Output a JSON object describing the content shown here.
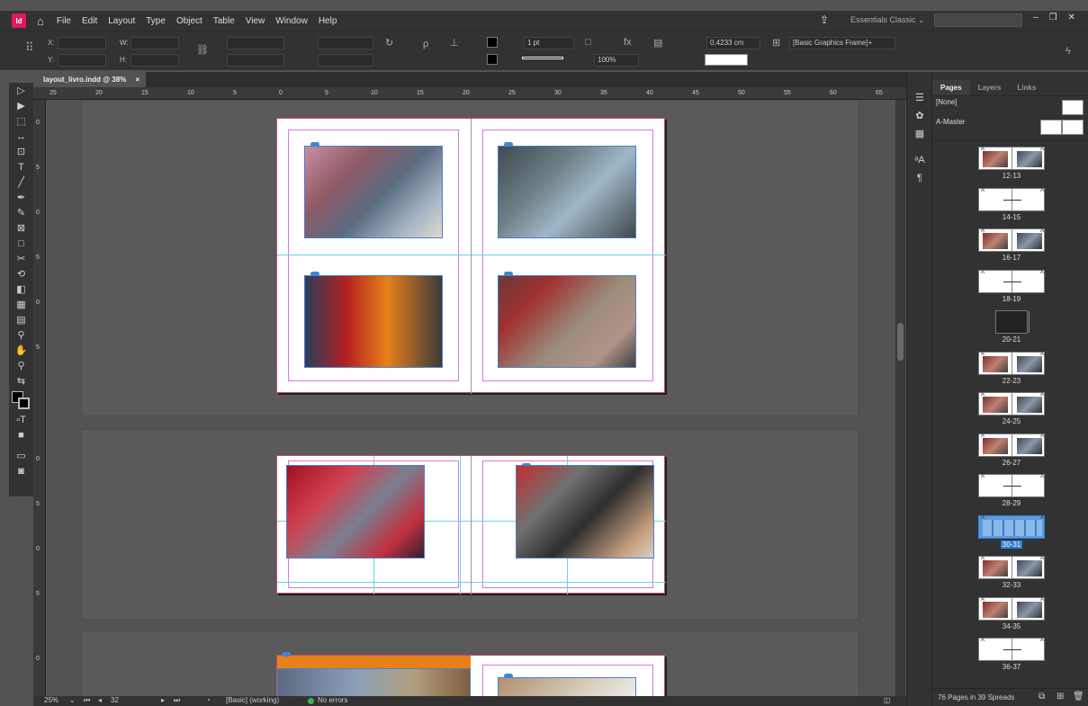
{
  "app": {
    "icon_label": "Id"
  },
  "menu": [
    "File",
    "Edit",
    "Layout",
    "Type",
    "Object",
    "Table",
    "View",
    "Window",
    "Help"
  ],
  "workspace": "Essentials Classic",
  "control": {
    "x_label": "X:",
    "y_label": "Y:",
    "w_label": "W:",
    "h_label": "H:",
    "stroke_weight": "1 pt",
    "opacity": "100%",
    "offset": "0,4233 cm",
    "object_style": "[Basic Graphics Frame]+"
  },
  "document_tab": {
    "title": "layout_livro.indd @ 38%",
    "close": "×"
  },
  "ruler_h": [
    "25",
    "20",
    "15",
    "10",
    "5",
    "0",
    "5",
    "10",
    "15",
    "20",
    "25",
    "30",
    "35",
    "40",
    "45",
    "50",
    "55",
    "60",
    "65"
  ],
  "ruler_v": [
    "0",
    "5",
    "0",
    "5",
    "0",
    "5",
    "0",
    "5",
    "0",
    "5",
    "0",
    "5",
    "0",
    "5"
  ],
  "panel": {
    "tabs": [
      "Pages",
      "Layers",
      "Links"
    ],
    "masters": [
      "[None]",
      "A-Master"
    ],
    "spreads": [
      {
        "label": "12-13",
        "kind": "photo"
      },
      {
        "label": "14-15",
        "kind": "blank"
      },
      {
        "label": "16-17",
        "kind": "photo"
      },
      {
        "label": "18-19",
        "kind": "blank"
      },
      {
        "label": "20-21",
        "kind": "dark"
      },
      {
        "label": "22-23",
        "kind": "photo"
      },
      {
        "label": "24-25",
        "kind": "photo"
      },
      {
        "label": "26-27",
        "kind": "photo"
      },
      {
        "label": "28-29",
        "kind": "blank"
      },
      {
        "label": "30-31",
        "kind": "selected"
      },
      {
        "label": "32-33",
        "kind": "photo"
      },
      {
        "label": "34-35",
        "kind": "photo"
      },
      {
        "label": "36-37",
        "kind": "blank"
      }
    ],
    "footer": "76 Pages in 39 Spreads",
    "master_letter": "A"
  },
  "status": {
    "zoom": "25%",
    "page": "32",
    "style": "[Basic] (working)",
    "errors": "No errors"
  },
  "colors": {
    "accent": "#2f7fd7",
    "app_brand": "#e2175f",
    "preflight_ok": "#39b54a"
  }
}
